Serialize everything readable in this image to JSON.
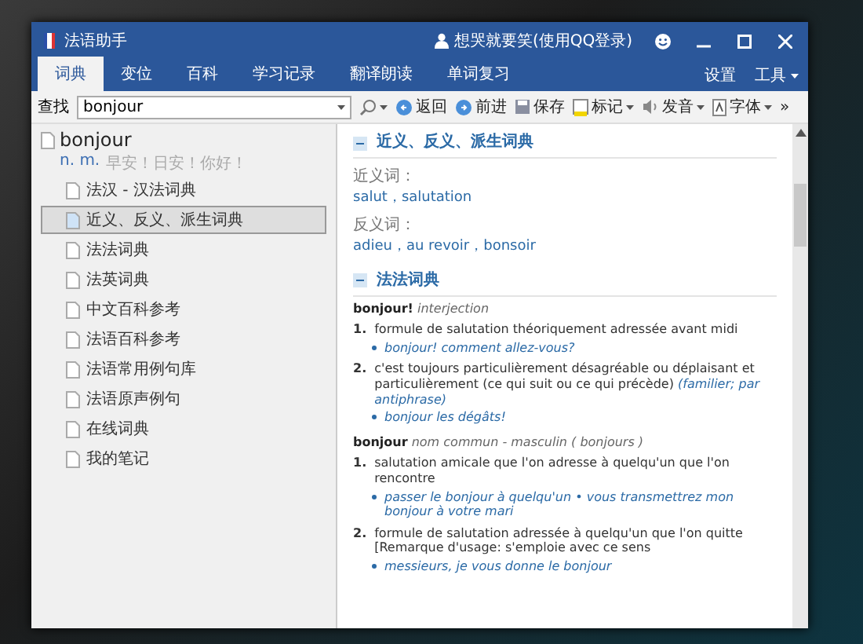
{
  "window": {
    "title": "法语助手",
    "user": "想哭就要笑(使用QQ登录)"
  },
  "tabs": [
    {
      "label": "词典",
      "selected": true
    },
    {
      "label": "变位",
      "selected": false
    },
    {
      "label": "百科",
      "selected": false
    },
    {
      "label": "学习记录",
      "selected": false
    },
    {
      "label": "翻译朗读",
      "selected": false
    },
    {
      "label": "单词复习",
      "selected": false
    }
  ],
  "menu": [
    {
      "label": "设置",
      "kind": "plain"
    },
    {
      "label": "工具",
      "kind": "dropdown"
    }
  ],
  "toolbar": {
    "search_label": "查找",
    "search_value": "bonjour",
    "buttons": [
      {
        "label": "返回",
        "kind": "back"
      },
      {
        "label": "前进",
        "kind": "forward"
      },
      {
        "label": "保存",
        "kind": "save"
      },
      {
        "label": "标记",
        "kind": "mark"
      },
      {
        "label": "发音",
        "kind": "speaker"
      },
      {
        "label": "字体",
        "kind": "font"
      }
    ],
    "more": "»"
  },
  "sidebar": {
    "headword": "bonjour",
    "pos": "n. m.",
    "meaning": "早安！日安！你好！",
    "items": [
      {
        "label": "法汉 - 汉法词典",
        "selected": false
      },
      {
        "label": "近义、反义、派生词典",
        "selected": true
      },
      {
        "label": "法法词典",
        "selected": false
      },
      {
        "label": "法英词典",
        "selected": false
      },
      {
        "label": "中文百科参考",
        "selected": false
      },
      {
        "label": "法语百科参考",
        "selected": false
      },
      {
        "label": "法语常用例句库",
        "selected": false
      },
      {
        "label": "法语原声例句",
        "selected": false
      },
      {
        "label": "在线词典",
        "selected": false
      },
      {
        "label": "我的笔记",
        "selected": false
      }
    ]
  },
  "content": {
    "synonyms_section": {
      "title": "近义、反义、派生词典",
      "groups": [
        {
          "label": "近义词：",
          "words": "salut，salutation"
        },
        {
          "label": "反义词：",
          "words": "adieu，au revoir，bonsoir"
        }
      ]
    },
    "definitions_section": {
      "title": "法法词典",
      "entries": [
        {
          "headword": "bonjour!",
          "grammar": "interjection",
          "senses": [
            {
              "number": "1.",
              "text": "formule de salutation théoriquement adressée avant midi",
              "examples": [
                "bonjour! comment allez-vous?"
              ]
            },
            {
              "number": "2.",
              "text": "c'est toujours particulièrement désagréable ou déplaisant et particulièrement (ce qui suit ou ce qui précède)",
              "note": "(familier; par antiphrase)",
              "examples": [
                "bonjour les dégâts!"
              ]
            }
          ]
        },
        {
          "headword": "bonjour",
          "grammar": "nom commun - masculin ( bonjours )",
          "senses": [
            {
              "number": "1.",
              "text": "salutation amicale que l'on adresse à quelqu'un que l'on rencontre",
              "examples": [
                "passer le bonjour à quelqu'un • vous transmettrez mon bonjour à votre mari"
              ]
            },
            {
              "number": "2.",
              "text": "formule de salutation adressée à quelqu'un que l'on quitte [Remarque d'usage: s'emploie avec ce sens",
              "examples": [
                "messieurs, je vous donne le bonjour"
              ]
            }
          ]
        }
      ]
    }
  }
}
